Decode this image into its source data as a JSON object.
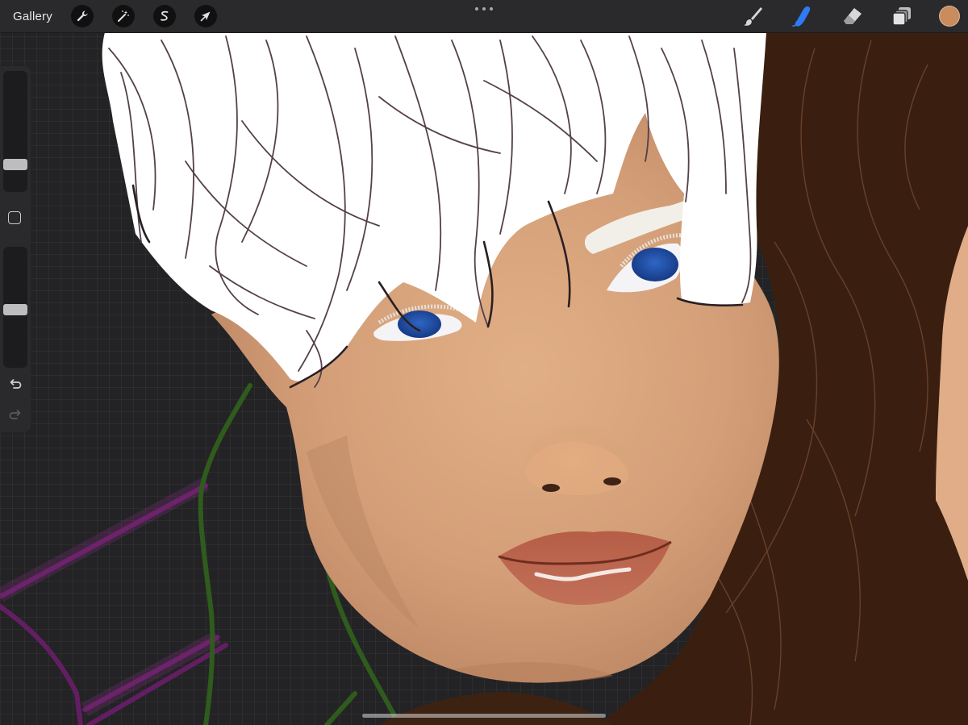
{
  "toolbar": {
    "gallery_label": "Gallery",
    "left_tools": [
      {
        "name": "actions",
        "icon": "wrench-icon"
      },
      {
        "name": "adjustments",
        "icon": "magic-wand-icon"
      },
      {
        "name": "selection",
        "icon": "selection-s-icon"
      },
      {
        "name": "transform",
        "icon": "arrow-cursor-icon"
      }
    ],
    "right_tools": [
      {
        "name": "brush",
        "icon": "brush-icon",
        "active": false
      },
      {
        "name": "smudge",
        "icon": "smudge-finger-icon",
        "active": true
      },
      {
        "name": "eraser",
        "icon": "eraser-icon",
        "active": false
      },
      {
        "name": "layers",
        "icon": "layers-icon",
        "active": false
      }
    ],
    "current_color": "#c98c5e",
    "active_tool_color": "#2f7bf5"
  },
  "sidebar": {
    "brush_size_level": 0.2,
    "opacity_level": 0.48,
    "modify_icon": "square-outline-icon",
    "undo_icon": "undo-arrow-icon",
    "redo_icon": "redo-arrow-icon",
    "redo_enabled": false
  },
  "canvas": {
    "background_color": "#232325",
    "palette": {
      "skin": "#d6a27a",
      "hair_white": "#ffffff",
      "hair_brown": "#3a1f10",
      "iris_blue": "#1f4fa8",
      "lips": "#b8644c",
      "sketch_green": "#2e5a1e",
      "sketch_purple": "#6b1e6a"
    }
  }
}
